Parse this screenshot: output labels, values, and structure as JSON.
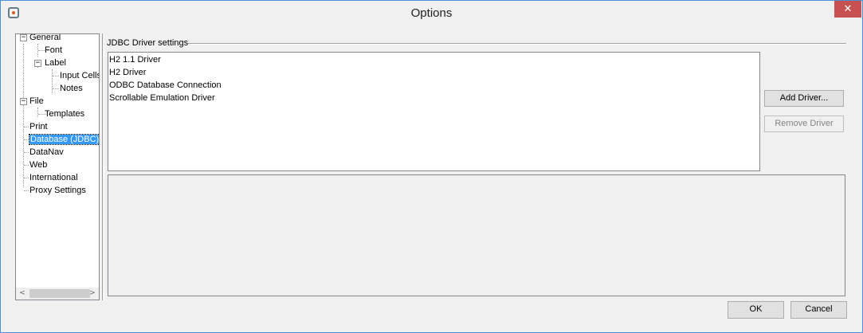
{
  "window": {
    "title": "Options",
    "close_glyph": "✕"
  },
  "tree": {
    "items": [
      {
        "label": "General",
        "expander": "−"
      },
      {
        "label": "Font"
      },
      {
        "label": "Label",
        "expander": "−"
      },
      {
        "label": "Input Cells"
      },
      {
        "label": "Notes"
      },
      {
        "label": "File",
        "expander": "−"
      },
      {
        "label": "Templates"
      },
      {
        "label": "Print"
      },
      {
        "label": "Database (JDBC)",
        "selected": true
      },
      {
        "label": "DataNav"
      },
      {
        "label": "Web"
      },
      {
        "label": "International"
      },
      {
        "label": "Proxy Settings"
      }
    ],
    "scroll_left_glyph": "<",
    "scroll_right_glyph": ">"
  },
  "jdbc": {
    "section_title": "JDBC Driver settings",
    "drivers": [
      "H2 1.1 Driver",
      "H2 Driver",
      "ODBC Database Connection",
      "Scrollable Emulation Driver"
    ],
    "add_driver_label": "Add Driver...",
    "remove_driver_label": "Remove Driver"
  },
  "footer": {
    "ok_label": "OK",
    "cancel_label": "Cancel"
  },
  "icons": {
    "app": "app-icon",
    "close": "close-icon",
    "expand": "collapse-icon"
  },
  "colors": {
    "selection": "#3399ff",
    "close_button": "#c75050",
    "window_border": "#4a90d9"
  }
}
